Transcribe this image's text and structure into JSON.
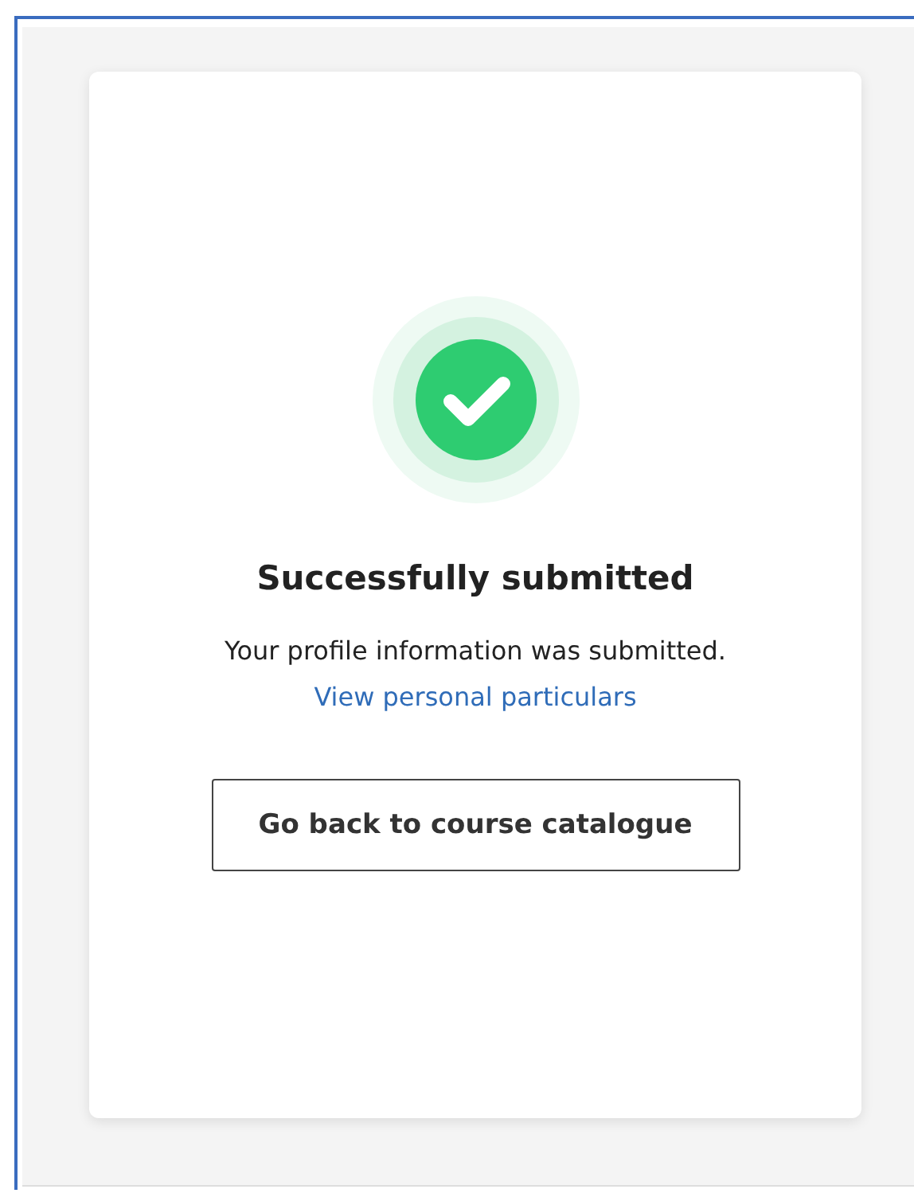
{
  "status": {
    "kind": "success",
    "title": "Successfully submitted",
    "message": "Your profile information was submitted.",
    "link": "View personal particulars"
  },
  "button": {
    "label": "Go back to course catalogue"
  }
}
